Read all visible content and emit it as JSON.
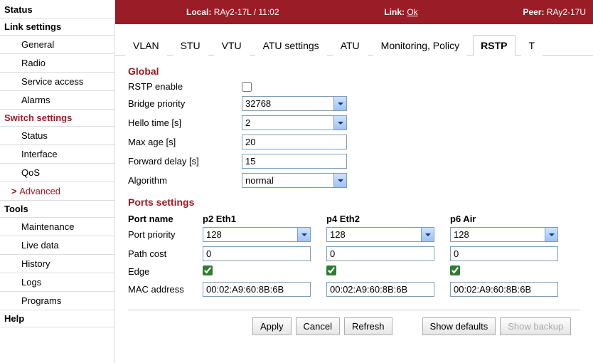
{
  "sidebar": {
    "status": "Status",
    "link_settings": "Link settings",
    "link_items": [
      "General",
      "Radio",
      "Service access",
      "Alarms"
    ],
    "switch_settings": "Switch settings",
    "switch_items": [
      "Status",
      "Interface",
      "QoS",
      "Advanced"
    ],
    "switch_active_index": 3,
    "tools": "Tools",
    "tool_items": [
      "Maintenance",
      "Live data",
      "History",
      "Logs",
      "Programs"
    ],
    "help": "Help"
  },
  "statusbar": {
    "local_label": "Local:",
    "local_value": "RAy2-17L / 11:02",
    "link_label": "Link:",
    "link_value": "Ok",
    "peer_label": "Peer:",
    "peer_value": "RAy2-17U"
  },
  "tabs": {
    "items": [
      "VLAN",
      "STU",
      "VTU",
      "ATU settings",
      "ATU",
      "Monitoring, Policy",
      "RSTP",
      "T"
    ],
    "active_index": 6
  },
  "global": {
    "title": "Global",
    "rstp_enable_label": "RSTP enable",
    "rstp_enable": false,
    "bridge_priority_label": "Bridge priority",
    "bridge_priority": "32768",
    "hello_time_label": "Hello time [s]",
    "hello_time": "2",
    "max_age_label": "Max age [s]",
    "max_age": "20",
    "forward_delay_label": "Forward delay [s]",
    "forward_delay": "15",
    "algorithm_label": "Algorithm",
    "algorithm": "normal"
  },
  "ports": {
    "title": "Ports settings",
    "col_name": "Port name",
    "col_priority": "Port priority",
    "col_path": "Path cost",
    "col_edge": "Edge",
    "col_mac": "MAC address",
    "cols": [
      {
        "name": "p2 Eth1",
        "priority": "128",
        "path": "0",
        "edge": true,
        "mac": "00:02:A9:60:8B:6B"
      },
      {
        "name": "p4 Eth2",
        "priority": "128",
        "path": "0",
        "edge": true,
        "mac": "00:02:A9:60:8B:6B"
      },
      {
        "name": "p6 Air",
        "priority": "128",
        "path": "0",
        "edge": true,
        "mac": "00:02:A9:60:8B:6B"
      }
    ]
  },
  "buttons": {
    "apply": "Apply",
    "cancel": "Cancel",
    "refresh": "Refresh",
    "show_defaults": "Show defaults",
    "show_backup": "Show backup"
  }
}
